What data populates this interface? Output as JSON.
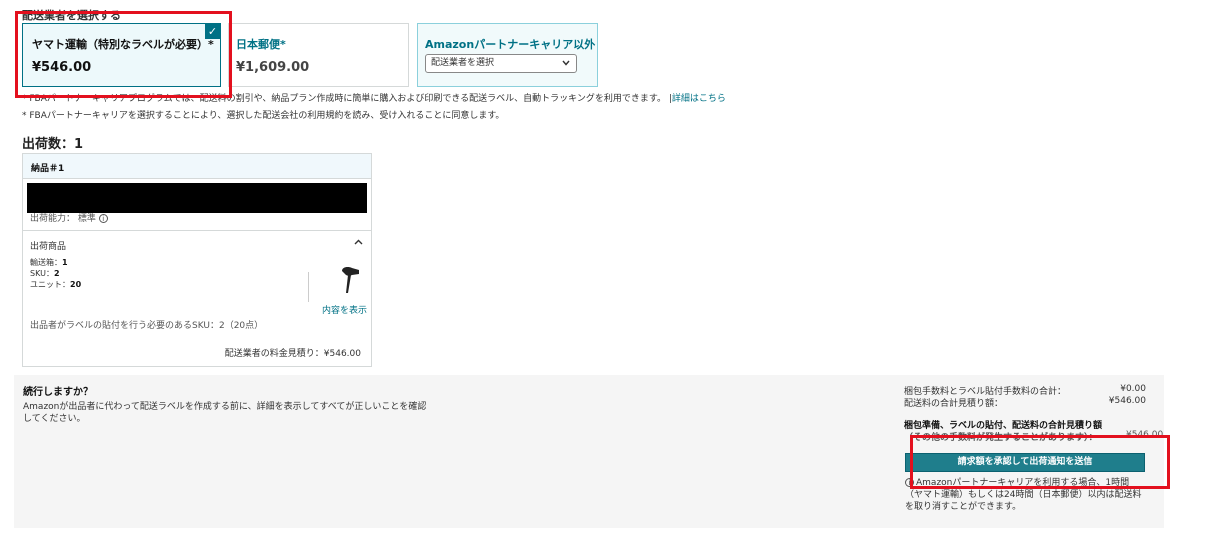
{
  "carrier_section": {
    "heading": "配送業者を選択する",
    "selected_check": "✓",
    "carriers": [
      {
        "name": "ヤマト運輸（特別なラベルが必要）*",
        "price": "¥546.00",
        "selected": true
      },
      {
        "name": "日本郵便*",
        "price": "¥1,609.00",
        "selected": false
      },
      {
        "name": "Amazonパートナーキャリア以外",
        "select_placeholder": "配送業者を選択"
      }
    ],
    "note1": "* FBAパートナーキャリアプログラムでは、配送料の割引や、納品プラン作成時に簡単に購入および印刷できる配送ラベル、自動トラッキングを利用できます。",
    "note1_link": "詳細はこちら",
    "note2": "* FBAパートナーキャリアを選択することにより、選択した配送会社の利用規約を読み、受け入れることに同意します。"
  },
  "shipments": {
    "count_label": "出荷数：1",
    "shipment": {
      "title": "納品＃1",
      "speed_label": "出荷能力：",
      "speed_value": "標準",
      "items_title": "出荷商品",
      "boxes_label": "輸送箱：",
      "boxes_value": "1",
      "sku_label": "SKU：",
      "sku_value": "2",
      "units_label": "ユニット：",
      "units_value": "20",
      "show_contents": "内容を表示",
      "labeling_note": "出品者がラベルの貼付を行う必要のあるSKU：2（20点）",
      "carrier_estimate": "配送業者の料金見積り：¥546.00"
    }
  },
  "summary": {
    "continue_title": "続行しますか？",
    "continue_desc": "Amazonが出品者に代わって配送ラベルを作成する前に、詳細を表示してすべてが正しいことを確認してください。",
    "prep_fee_label": "梱包手数料とラベル貼付手数料の合計：",
    "prep_fee_value": "¥0.00",
    "shipping_estimate_label": "配送料の合計見積り額：",
    "shipping_estimate_value": "¥546.00",
    "total_title": "梱包準備、ラベルの貼付、配送料の合計見積り額",
    "total_sub": "（その他の手数料が発生することがあります）：",
    "total_value": "¥546.00",
    "submit_button": "請求額を承認して出荷通知を送信",
    "cancel_note": "Amazonパートナーキャリアを利用する場合、1時間（ヤマト運輸）もしくは24時間（日本郵便）以内は配送料を取り消すことができます。"
  },
  "colors": {
    "accent": "#007185",
    "button": "#1f7e8c",
    "highlight_box": "#e3101e"
  }
}
